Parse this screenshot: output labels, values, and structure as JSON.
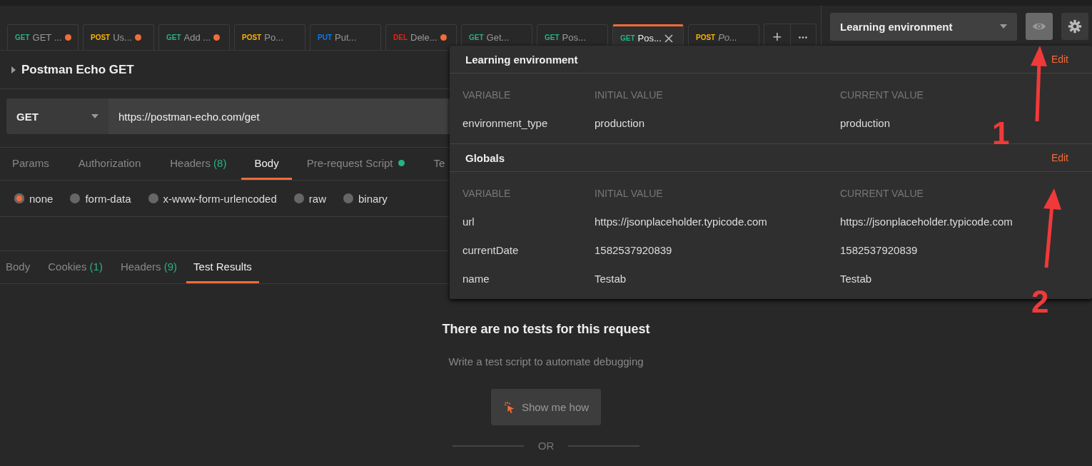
{
  "request_tabs": [
    {
      "method": "GET",
      "color": "#26b47f",
      "name": "GET ...",
      "unsaved": true,
      "selected": false,
      "preview": false
    },
    {
      "method": "POST",
      "color": "#ffb400",
      "name": "Us...",
      "unsaved": true,
      "selected": false,
      "preview": false
    },
    {
      "method": "GET",
      "color": "#26b47f",
      "name": "Add ...",
      "unsaved": true,
      "selected": false,
      "preview": false
    },
    {
      "method": "POST",
      "color": "#ffb400",
      "name": "Po...",
      "unsaved": false,
      "selected": false,
      "preview": false
    },
    {
      "method": "PUT",
      "color": "#097bed",
      "name": "Put...",
      "unsaved": false,
      "selected": false,
      "preview": false
    },
    {
      "method": "DEL",
      "color": "#eb2013",
      "name": "Dele...",
      "unsaved": true,
      "selected": false,
      "preview": false
    },
    {
      "method": "GET",
      "color": "#26b47f",
      "name": "Get...",
      "unsaved": false,
      "selected": false,
      "preview": false
    },
    {
      "method": "GET",
      "color": "#26b47f",
      "name": "Pos...",
      "unsaved": false,
      "selected": false,
      "preview": false
    },
    {
      "method": "GET",
      "color": "#26b47f",
      "name": "Pos...",
      "unsaved": false,
      "selected": true,
      "preview": false
    },
    {
      "method": "POST",
      "color": "#ffb400",
      "name": "Po...",
      "unsaved": false,
      "selected": false,
      "preview": true
    }
  ],
  "add_tab": "+",
  "more_tabs": "•••",
  "environment": {
    "value": "Learning environment"
  },
  "request": {
    "name": "Postman Echo GET",
    "method": "GET",
    "url": "https://postman-echo.com/get"
  },
  "request_tabs_bar": [
    {
      "label": "Params",
      "selected": false
    },
    {
      "label": "Authorization",
      "selected": false
    },
    {
      "label": "Headers",
      "count": "(8)",
      "selected": false
    },
    {
      "label": "Body",
      "selected": true
    },
    {
      "label": "Pre-request Script",
      "dot": true,
      "selected": false
    },
    {
      "label": "Te",
      "selected": false
    }
  ],
  "body_types": [
    {
      "label": "none",
      "selected": true
    },
    {
      "label": "form-data",
      "selected": false
    },
    {
      "label": "x-www-form-urlencoded",
      "selected": false
    },
    {
      "label": "raw",
      "selected": false
    },
    {
      "label": "binary",
      "selected": false
    }
  ],
  "response_tabs": [
    {
      "label": "Body",
      "selected": false
    },
    {
      "label": "Cookies",
      "count": "(1)",
      "selected": false
    },
    {
      "label": "Headers",
      "count": "(9)",
      "selected": false
    },
    {
      "label": "Test Results",
      "selected": true
    }
  ],
  "empty_state": {
    "title": "There are no tests for this request",
    "text": "Write a test script to automate debugging",
    "button": "Show me how",
    "divider": "OR"
  },
  "environment_popup": {
    "sections": [
      {
        "title": "Learning environment",
        "edit": "Edit",
        "columns": [
          "VARIABLE",
          "INITIAL VALUE",
          "CURRENT VALUE"
        ],
        "rows": [
          [
            "environment_type",
            "production",
            "production"
          ]
        ]
      },
      {
        "title": "Globals",
        "edit": "Edit",
        "columns": [
          "VARIABLE",
          "INITIAL VALUE",
          "CURRENT VALUE"
        ],
        "rows": [
          [
            "url",
            "https://jsonplaceholder.typicode.com",
            "https://jsonplaceholder.typicode.com"
          ],
          [
            "currentDate",
            "1582537920839",
            "1582537920839"
          ],
          [
            "name",
            "Testab",
            "Testab"
          ]
        ]
      }
    ]
  },
  "annotations": [
    "1",
    "2"
  ]
}
